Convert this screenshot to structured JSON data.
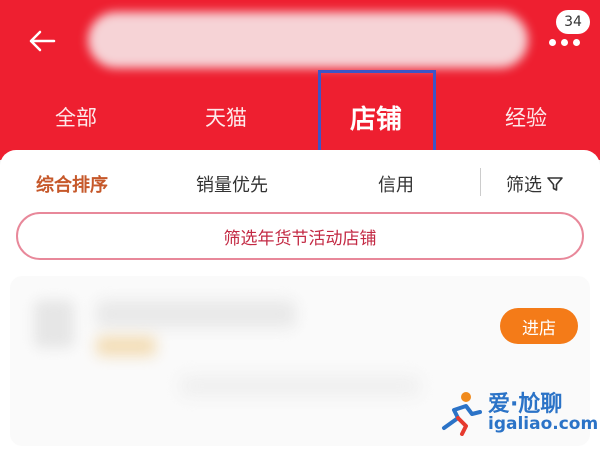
{
  "header": {
    "badge_count": "34",
    "bg_color": "#ee1f30"
  },
  "tabs": [
    {
      "label": "全部",
      "active": false
    },
    {
      "label": "天猫",
      "active": false
    },
    {
      "label": "店铺",
      "active": true
    },
    {
      "label": "经验",
      "active": false
    }
  ],
  "sort": {
    "items": [
      {
        "label": "综合排序",
        "active": true
      },
      {
        "label": "销量优先",
        "active": false
      },
      {
        "label": "信用",
        "active": false
      }
    ],
    "filter_label": "筛选",
    "filter_icon": "filter-funnel-icon"
  },
  "promo": {
    "label": "筛选年货节活动店铺"
  },
  "shop": {
    "enter_label": "进店",
    "enter_color": "#f47b18"
  },
  "watermark": {
    "title": "爱·尬聊",
    "url": "igaliao.com"
  },
  "colors": {
    "annotation_box": "#3d55c6",
    "active_sort": "#c6582a",
    "promo_text": "#c32a44"
  }
}
